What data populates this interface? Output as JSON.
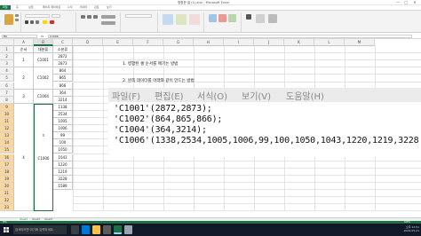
{
  "window": {
    "title": "병합한 셀 (1).xlsx - Microsoft Excel",
    "controls": [
      "—",
      "□",
      "✕"
    ]
  },
  "ribbon": {
    "tabs": [
      "파일",
      "홈",
      "삽입",
      "페이지 레이아웃",
      "수식",
      "데이터",
      "검토",
      "보기"
    ],
    "active_tab": "홈"
  },
  "formula_bar": {
    "name_box": "B9",
    "fx": "fx",
    "content": "C1006"
  },
  "grid": {
    "columns": [
      "A",
      "B",
      "C",
      "D",
      "E",
      "F",
      "G",
      "H",
      "I",
      "J",
      "K",
      "L",
      "M"
    ],
    "selected_column": "B",
    "rows": [
      "1",
      "2",
      "3",
      "4",
      "5",
      "6",
      "7",
      "8",
      "9",
      "10",
      "11",
      "12",
      "13",
      "14",
      "15",
      "16",
      "17",
      "18",
      "19",
      "20",
      "21",
      "22",
      "23"
    ],
    "header_row": {
      "a": "순서",
      "b": "대분류",
      "c": "소분류"
    },
    "groups": [
      {
        "order": "1",
        "category": "C1001"
      },
      {
        "order": "2",
        "category": "C1002"
      },
      {
        "order": "3",
        "category": "C1004"
      },
      {
        "order": "4",
        "category": "C1006"
      }
    ],
    "c_values": [
      "2872",
      "2873",
      "864",
      "865",
      "866",
      "364",
      "3214",
      "1338",
      "2534",
      "1005",
      "1006",
      "99",
      "100",
      "1050",
      "1043",
      "1220",
      "1219",
      "3228",
      "1589"
    ],
    "merged_stray": "ㅎ"
  },
  "notes": {
    "line1": "1. 병합된 셀 순서를 매기는 방법",
    "line2": "2. 왼쪽 데이터를 아래와 같이 만드는 방법"
  },
  "notepad": {
    "menu": [
      "파일(F)",
      "편집(E)",
      "서식(O)",
      "보기(V)",
      "도움말(H)"
    ],
    "lines": [
      "'C1001'(2872,2873);",
      "'C1002'(864,865,866);",
      "'C1004'(364,3214);",
      "'C1006'(1338,2534,1005,1006,99,100,1050,1043,1220,1219,3228"
    ]
  },
  "sheets": {
    "tabs": [
      "Sheet1",
      "Sheet2",
      "Sheet3"
    ],
    "active": "Sheet1"
  },
  "status": {
    "left": "준비",
    "right": "100%"
  },
  "taskbar": {
    "search_placeholder": "검색하려면 여기에 입력하세요.",
    "time": "오후 12:51",
    "date": "2019-05-21"
  },
  "colors": {
    "excel_green": "#1e7145",
    "row_selected": "#fad7a0",
    "taskbar": "#111827"
  }
}
